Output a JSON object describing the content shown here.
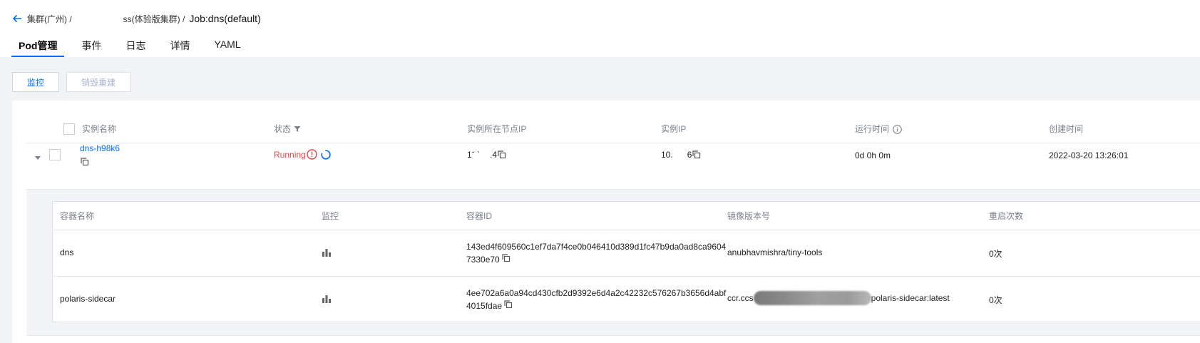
{
  "breadcrumb": {
    "cluster_label": "集群(广州) /",
    "cluster_name": "ss(体验版集群) /",
    "title": "Job:dns(default)"
  },
  "tabs": [
    {
      "label": "Pod管理",
      "active": true
    },
    {
      "label": "事件",
      "active": false
    },
    {
      "label": "日志",
      "active": false
    },
    {
      "label": "详情",
      "active": false
    },
    {
      "label": "YAML",
      "active": false
    }
  ],
  "toolbar": {
    "monitor_label": "监控",
    "destroy_label": "销毁重建"
  },
  "pod_table": {
    "headers": {
      "name": "实例名称",
      "status": "状态",
      "node_ip": "实例所在节点IP",
      "pod_ip": "实例IP",
      "runtime": "运行时间",
      "created": "创建时间"
    },
    "rows": [
      {
        "name": "dns-h98k6",
        "status": "Running",
        "node_ip_start": "1ˉ ˋ",
        "node_ip_end": ".4",
        "pod_ip_start": "10.",
        "pod_ip_end": "6",
        "runtime": "0d 0h 0m",
        "created": "2022-03-20 13:26:01"
      }
    ]
  },
  "container_table": {
    "headers": {
      "name": "容器名称",
      "monitor": "监控",
      "id": "容器ID",
      "image": "镜像版本号",
      "restarts": "重启次数"
    },
    "rows": [
      {
        "name": "dns",
        "id_line1": "143ed4f609560c1ef7da7f4ce0b046410d389d1fc47b9da0ad8ca9604",
        "id_line2": "7330e70",
        "image_start": "anubhavmishra/tiny-tools",
        "image_end": "",
        "restarts": "0次"
      },
      {
        "name": "polaris-sidecar",
        "id_line1": "4ee702a6a0a94cd430cfb2d9392e6d4a2c42232c576267b3656d4abf",
        "id_line2": "4015fdae",
        "image_start": "ccr.ccs",
        "image_end": "polaris-sidecar:latest",
        "restarts": "0次"
      }
    ]
  },
  "colors": {
    "accent": "#006eff",
    "error": "#e54545",
    "background": "#f2f3f5"
  },
  "icons": [
    "back-arrow-icon",
    "filter-icon",
    "info-icon",
    "copy-icon",
    "error-icon",
    "loading-icon",
    "bar-chart-icon",
    "caret-down-icon"
  ]
}
